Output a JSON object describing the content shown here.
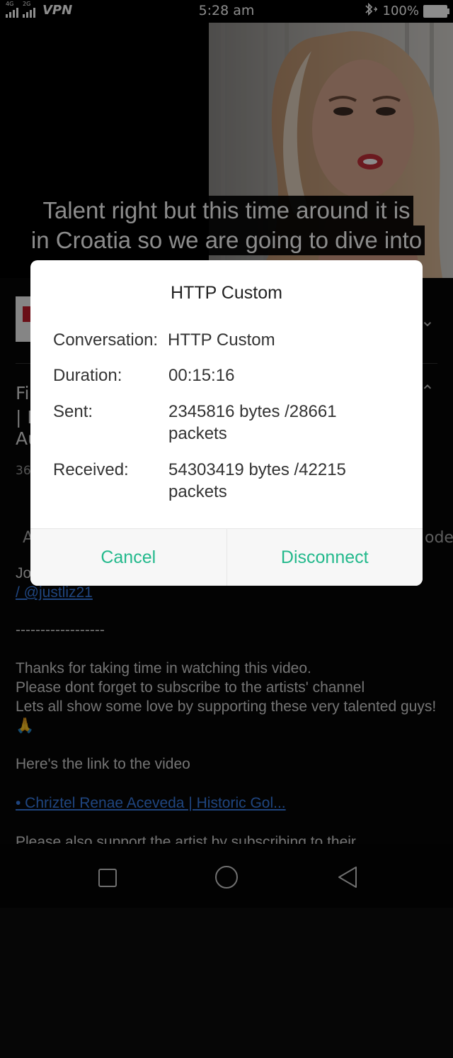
{
  "status_bar": {
    "net1": "4G",
    "net2": "2G",
    "vpn": "VPN",
    "time": "5:28 am",
    "battery": "100%"
  },
  "video": {
    "caption_line1": "Talent right but this time around it is",
    "caption_line2": "in Croatia so we are going to dive into"
  },
  "background": {
    "title_fragments": [
      "Fi",
      "| H",
      "Au"
    ],
    "views_fragment": "36",
    "tab_left_fragment": "A",
    "tab_right_fragment": "ode",
    "desc_fragment": "Jo",
    "handle_link": "/ @justliz21",
    "separator": "------------------",
    "para1": "Thanks for taking time in watching this video.",
    "para2": "Please dont forget to subscribe to the artists' channel",
    "para3": "Lets all show some love by supporting these very talented guys! 🙏",
    "para4": "Here's the link to the video",
    "video_link": "• Chriztel Renae Aceveda | Historic Gol...",
    "para5": "Please also support the artist by subscribing to their"
  },
  "dialog": {
    "title": "HTTP Custom",
    "conversation_label": "Conversation:",
    "conversation_value": "HTTP Custom",
    "duration_label": "Duration:",
    "duration_value": "00:15:16",
    "sent_label": "Sent:",
    "sent_value": "2345816 bytes /28661 packets",
    "received_label": "Received:",
    "received_value": "54303419 bytes /42215 packets",
    "cancel": "Cancel",
    "disconnect": "Disconnect"
  },
  "colors": {
    "accent": "#23b98c",
    "link": "#3a7ee8"
  }
}
